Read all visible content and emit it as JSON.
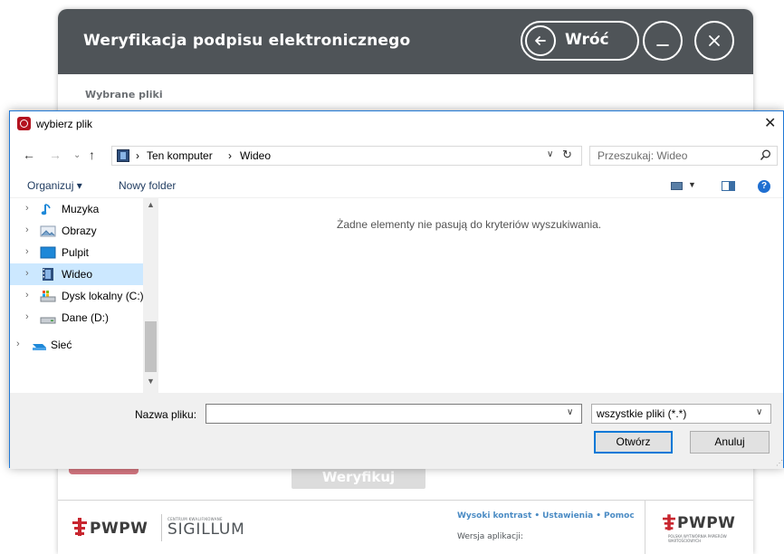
{
  "app": {
    "title": "Weryfikacja podpisu elektronicznego",
    "back_label": "Wróć",
    "section_label": "Wybrane pliki",
    "verify_label": "Weryfikuj",
    "footer": {
      "logo_left_mark": "PWPW",
      "logo_left_small": "CENTRUM KWALIFIKOWANE",
      "logo_left_big": "SIGILLUM",
      "links": [
        "Wysoki kontrast",
        "Ustawienia",
        "Pomoc"
      ],
      "version_label": "Wersja aplikacji:",
      "logo_right_mark": "PWPW",
      "logo_right_sub": "POLSKA WYTWÓRNIA PAPIERÓW WARTOŚCIOWYCH"
    }
  },
  "dialog": {
    "title": "wybierz plik",
    "close_glyph": "✕",
    "breadcrumb": [
      "Ten komputer",
      "Wideo"
    ],
    "search_placeholder": "Przeszukaj: Wideo",
    "toolbar": {
      "organize": "Organizuj ▾",
      "new_folder": "Nowy folder"
    },
    "nav_items": [
      {
        "label": "Muzyka",
        "icon": "music-icon"
      },
      {
        "label": "Obrazy",
        "icon": "pictures-icon"
      },
      {
        "label": "Pulpit",
        "icon": "desktop-icon"
      },
      {
        "label": "Wideo",
        "icon": "video-icon",
        "selected": true
      },
      {
        "label": "Dysk lokalny (C:)",
        "icon": "drive-c-icon"
      },
      {
        "label": "Dane (D:)",
        "icon": "drive-d-icon"
      },
      {
        "label": "Sieć",
        "icon": "network-icon"
      }
    ],
    "empty_message": "Żadne elementy nie pasują do kryteriów wyszukiwania.",
    "filename_label": "Nazwa pliku:",
    "filename_value": "",
    "filter_value": "wszystkie pliki (*.*)",
    "open_label": "Otwórz",
    "cancel_label": "Anuluj"
  },
  "colors": {
    "header_bg": "#4f5458",
    "link_blue": "#4a8bc4",
    "selection": "#cce8ff",
    "dialog_border": "#1f78d6"
  }
}
